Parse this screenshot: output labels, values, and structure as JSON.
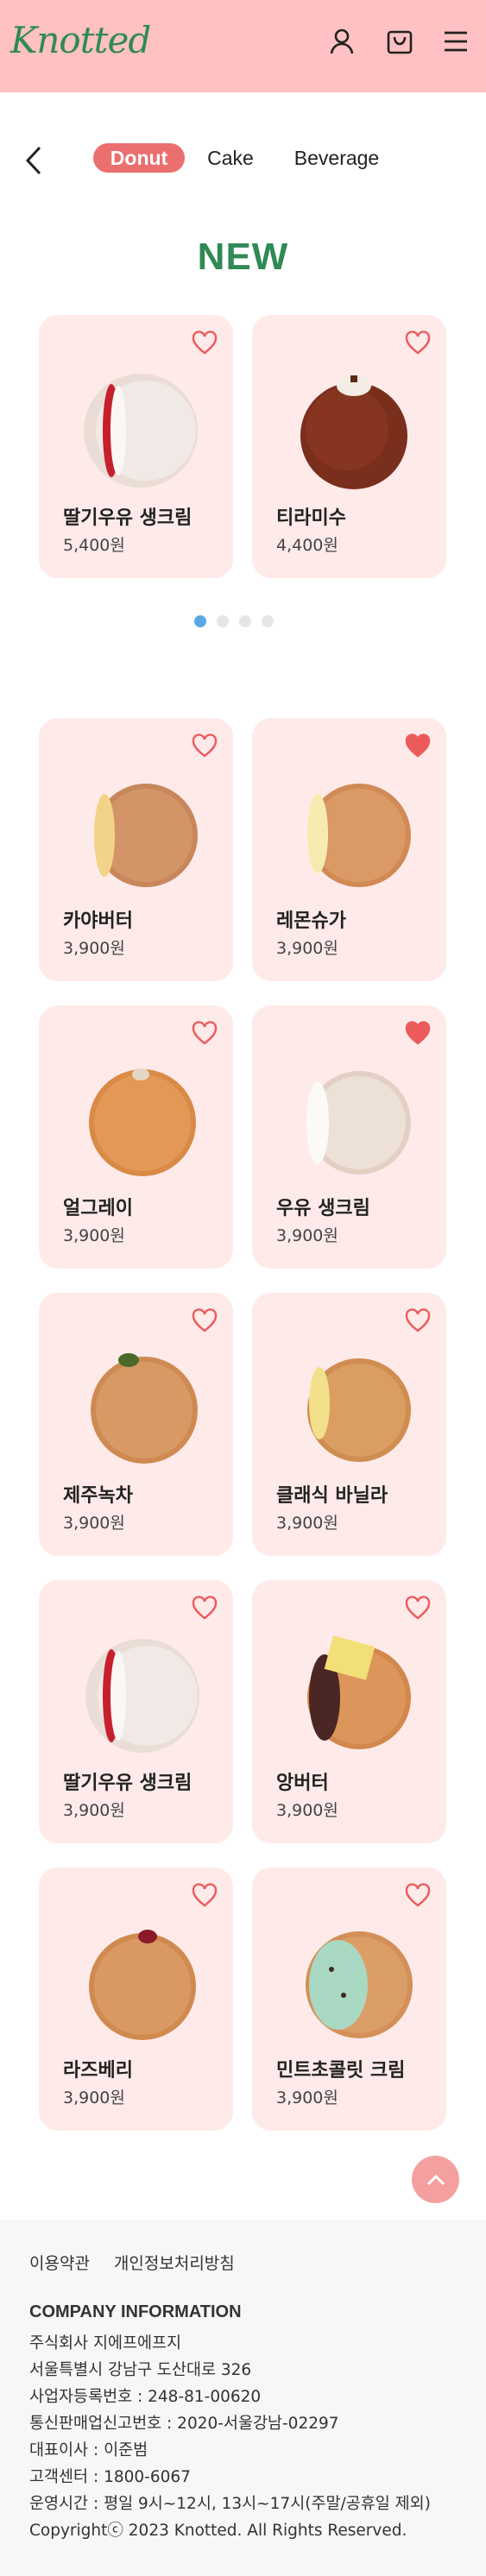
{
  "header": {
    "logo": "Knotted",
    "icons": [
      "user-icon",
      "bag-icon",
      "menu-icon"
    ]
  },
  "tabs": [
    {
      "label": "Donut",
      "active": true
    },
    {
      "label": "Cake",
      "active": false
    },
    {
      "label": "Beverage",
      "active": false
    }
  ],
  "new_section": {
    "title": "NEW",
    "items": [
      {
        "name": "딸기우유 생크림",
        "price": "5,400원",
        "liked": false
      },
      {
        "name": "티라미수",
        "price": "4,400원",
        "liked": false
      }
    ],
    "carousel": {
      "total": 4,
      "active": 1
    }
  },
  "products": [
    {
      "name": "카야버터",
      "price": "3,900원",
      "liked": false
    },
    {
      "name": "레몬슈가",
      "price": "3,900원",
      "liked": true
    },
    {
      "name": "얼그레이",
      "price": "3,900원",
      "liked": false
    },
    {
      "name": "우유 생크림",
      "price": "3,900원",
      "liked": true
    },
    {
      "name": "제주녹차",
      "price": "3,900원",
      "liked": false
    },
    {
      "name": "클래식 바닐라",
      "price": "3,900원",
      "liked": false
    },
    {
      "name": "딸기우유 생크림",
      "price": "3,900원",
      "liked": false
    },
    {
      "name": "앙버터",
      "price": "3,900원",
      "liked": false
    },
    {
      "name": "라즈베리",
      "price": "3,900원",
      "liked": false
    },
    {
      "name": "민트초콜릿 크림",
      "price": "3,900원",
      "liked": false
    }
  ],
  "footer": {
    "links": [
      "이용약관",
      "개인정보처리방침"
    ],
    "company_title": "COMPANY INFORMATION",
    "lines": [
      "주식회사 지에프에프지",
      "서울특별시 강남구 도산대로 326",
      "사업자등록번호 : 248-81-00620",
      "통신판매업신고번호 : 2020-서울강남-02297",
      "대표이사 : 이준범",
      "고객센터 : 1800-6067",
      "운영시간 : 평일 9시~12시, 13시~17시(주말/공휴일 제외)",
      "Copyrightⓒ 2023 Knotted. All Rights Reserved."
    ]
  },
  "colors": {
    "header_bg": "#ffc1c1",
    "brand_green": "#2f8a55",
    "active_tab": "#ec6f6f",
    "card_bg": "#ffeaea",
    "heart": "#ec5b5b",
    "dot_active": "#5aa9e6"
  }
}
